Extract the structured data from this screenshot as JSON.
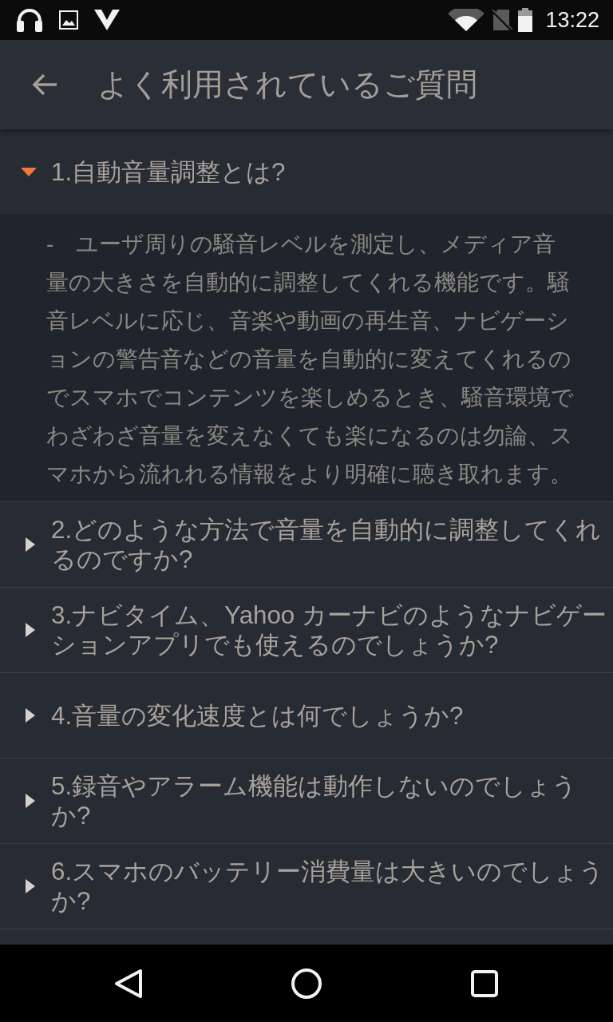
{
  "status_bar": {
    "time": "13:22"
  },
  "app_bar": {
    "title": "よく利用されているご質問"
  },
  "faq": [
    {
      "question": "1.自動音量調整とは?",
      "expanded": true,
      "answer": "-　ユーザ周りの騒音レベルを測定し、メディア音量の大きさを自動的に調整してくれる機能です。騒音レベルに応じ、音楽や動画の再生音、ナビゲーションの警告音などの音量を自動的に変えてくれるのでスマホでコンテンツを楽しめるとき、騒音環境でわざわざ音量を変えなくても楽になるのは勿論、スマホから流れれる情報をより明確に聴き取れます。"
    },
    {
      "question": "2.どのような方法で音量を自動的に調整してくれるのですか?",
      "expanded": false
    },
    {
      "question": "3.ナビタイム、Yahoo カーナビのようなナビゲーションアプリでも使えるのでしょうか?",
      "expanded": false
    },
    {
      "question": "4.音量の変化速度とは何でしょうか?",
      "expanded": false
    },
    {
      "question": "5.録音やアラーム機能は動作しないのでしょうか?",
      "expanded": false
    },
    {
      "question": "6.スマホのバッテリー消費量は大きいのでしょうか?",
      "expanded": false
    }
  ]
}
